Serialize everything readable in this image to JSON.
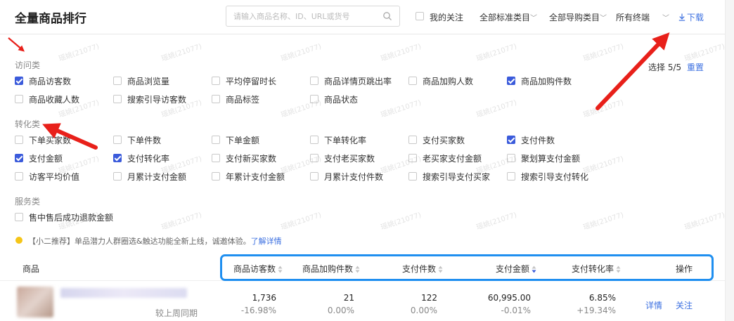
{
  "header": {
    "title": "全量商品排行",
    "search_placeholder": "请输入商品名称、ID、URL或货号",
    "my_follow": "我的关注",
    "std_category": "全部标准类目",
    "guide_category": "全部导购类目",
    "terminal": "所有终端",
    "download": "下载"
  },
  "selection": {
    "count_text": "选择 5/5",
    "reset": "重置"
  },
  "sections": {
    "visit": {
      "title": "访问类",
      "options": [
        {
          "label": "商品访客数",
          "checked": true
        },
        {
          "label": "商品浏览量",
          "checked": false
        },
        {
          "label": "平均停留时长",
          "checked": false
        },
        {
          "label": "商品详情页跳出率",
          "checked": false
        },
        {
          "label": "商品加购人数",
          "checked": false
        },
        {
          "label": "商品加购件数",
          "checked": true
        },
        {
          "label": "商品收藏人数",
          "checked": false
        },
        {
          "label": "搜索引导访客数",
          "checked": false
        },
        {
          "label": "商品标签",
          "checked": false
        },
        {
          "label": "商品状态",
          "checked": false
        }
      ]
    },
    "convert": {
      "title": "转化类",
      "options": [
        {
          "label": "下单买家数",
          "checked": false
        },
        {
          "label": "下单件数",
          "checked": false
        },
        {
          "label": "下单金额",
          "checked": false
        },
        {
          "label": "下单转化率",
          "checked": false
        },
        {
          "label": "支付买家数",
          "checked": false
        },
        {
          "label": "支付件数",
          "checked": true
        },
        {
          "label": "支付金额",
          "checked": true
        },
        {
          "label": "支付转化率",
          "checked": true
        },
        {
          "label": "支付新买家数",
          "checked": false
        },
        {
          "label": "支付老买家数",
          "checked": false
        },
        {
          "label": "老买家支付金额",
          "checked": false
        },
        {
          "label": "聚划算支付金额",
          "checked": false
        },
        {
          "label": "访客平均价值",
          "checked": false
        },
        {
          "label": "月累计支付金额",
          "checked": false
        },
        {
          "label": "年累计支付金额",
          "checked": false
        },
        {
          "label": "月累计支付件数",
          "checked": false
        },
        {
          "label": "搜索引导支付买家",
          "checked": false
        },
        {
          "label": "搜索引导支付转化",
          "checked": false
        }
      ]
    },
    "service": {
      "title": "服务类",
      "options": [
        {
          "label": "售中售后成功退款金额",
          "checked": false
        }
      ]
    }
  },
  "tip": {
    "text": "【小二推荐】单品潜力人群圈选&触达功能全新上线，诚邀体验。",
    "link": "了解详情"
  },
  "table": {
    "headers": {
      "product": "商品",
      "visitors": "商品访客数",
      "cart_items": "商品加购件数",
      "pay_items": "支付件数",
      "pay_amount": "支付金额",
      "pay_rate": "支付转化率",
      "actions": "操作"
    },
    "rows": [
      {
        "compare_label": "较上周同期",
        "visitors": "1,736",
        "visitors_change": "-16.98%",
        "cart_items": "21",
        "cart_items_change": "0.00%",
        "pay_items": "122",
        "pay_items_change": "0.00%",
        "pay_amount": "60,995.00",
        "pay_amount_change": "-0.01%",
        "pay_rate": "6.85%",
        "pay_rate_change": "+19.34%",
        "detail": "详情",
        "follow": "关注"
      }
    ]
  },
  "watermark_text": "瑶姚(21077)",
  "colors": {
    "accent": "#3b5bdb",
    "link": "#3b6fe0",
    "highlight": "#1f8ff0",
    "arrow": "#e8201a"
  }
}
